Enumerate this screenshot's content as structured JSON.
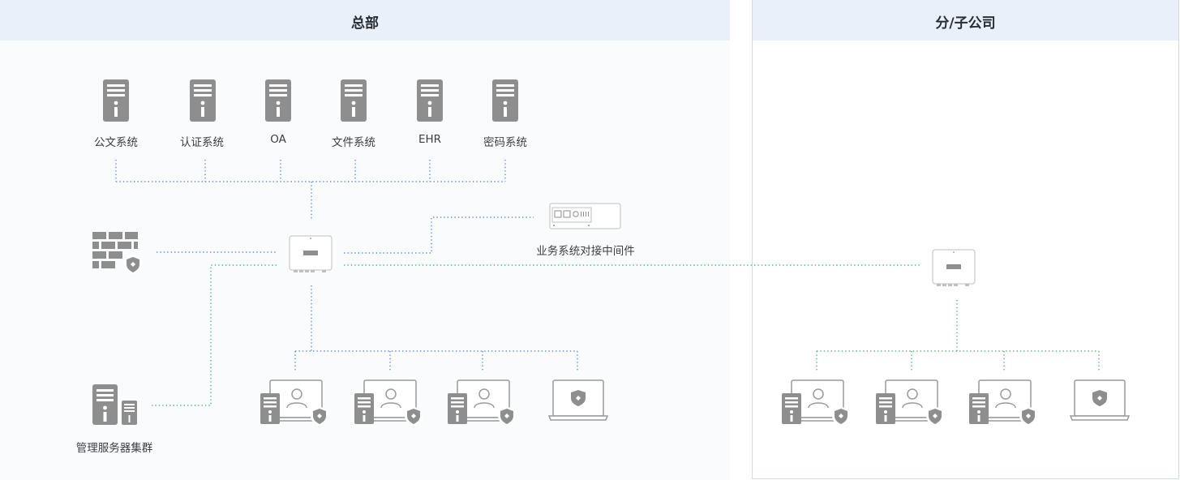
{
  "headquarters": {
    "title": "总部",
    "systems": [
      {
        "label": "公文系统"
      },
      {
        "label": "认证系统"
      },
      {
        "label": "OA"
      },
      {
        "label": "文件系统"
      },
      {
        "label": "EHR"
      },
      {
        "label": "密码系统"
      }
    ],
    "middleware_label": "业务系统对接中间件",
    "server_cluster_label": "管理服务器集群",
    "terminal_count": 4
  },
  "branch": {
    "title": "分/子公司",
    "terminal_count": 4
  },
  "colors": {
    "panel_header": "#eaf0fa",
    "icon_gray": "#8e8e8e",
    "link_blue": "#4a79c9",
    "link_green": "#39a96b"
  }
}
